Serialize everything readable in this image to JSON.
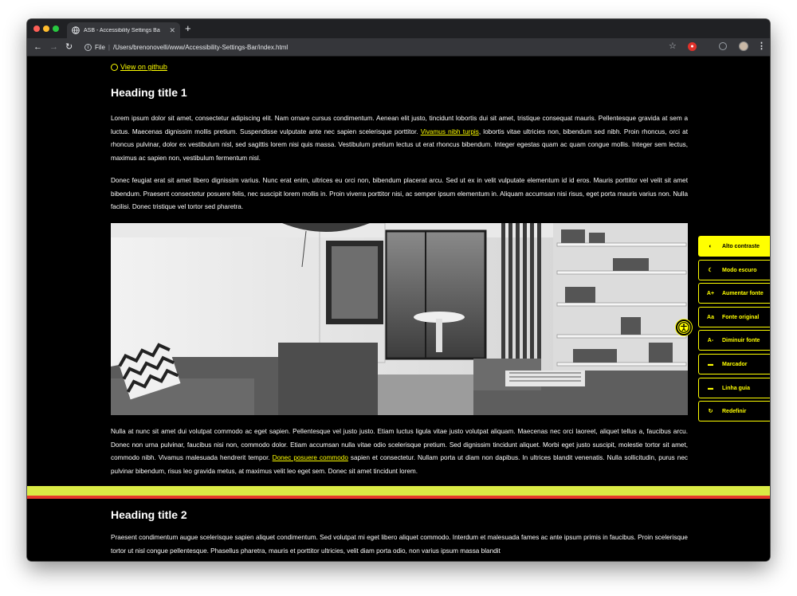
{
  "browser": {
    "tab_title": "ASB - Accessibility Settings Ba",
    "tab_close": "✕",
    "new_tab": "+",
    "url_scheme": "File",
    "url_separator": "|",
    "url_path": "/Users/brenonovelli/www/Accessibility-Settings-Bar/index.html"
  },
  "page": {
    "github_link": "View on github",
    "heading1": "Heading title 1",
    "para1_a": "Lorem ipsum dolor sit amet, consectetur adipiscing elit. Nam ornare cursus condimentum. Aenean elit justo, tincidunt lobortis dui sit amet, tristique consequat mauris. Pellentesque gravida at sem a luctus. Maecenas dignissim mollis pretium. Suspendisse vulputate ante nec sapien scelerisque porttitor. ",
    "para1_link": "Vivamus nibh turpis",
    "para1_b": ", lobortis vitae ultricies non, bibendum sed nibh. Proin rhoncus, orci at rhoncus pulvinar, dolor ex vestibulum nisl, sed sagittis lorem nisi quis massa. Vestibulum pretium lectus ut erat rhoncus bibendum. Integer egestas quam ac quam congue mollis. Integer sem lectus, maximus ac sapien non, vestibulum fermentum nisl.",
    "para2": "Donec feugiat erat sit amet libero dignissim varius. Nunc erat enim, ultrices eu orci non, bibendum placerat arcu. Sed ut ex in velit vulputate elementum id id eros. Mauris porttitor vel velit sit amet bibendum. Praesent consectetur posuere felis, nec suscipit lorem mollis in. Proin viverra porttitor nisi, ac semper ipsum elementum in. Aliquam accumsan nisi risus, eget porta mauris varius non. Nulla facilisi. Donec tristique vel tortor sed pharetra.",
    "para3_a": "Nulla at nunc sit amet dui volutpat commodo ac eget sapien. Pellentesque vel justo justo. Etiam luctus ligula vitae justo volutpat aliquam. Maecenas nec orci laoreet, aliquet tellus a, faucibus arcu. Donec non urna pulvinar, faucibus nisi non, commodo dolor. Etiam accumsan nulla vitae odio scelerisque pretium. Sed dignissim tincidunt aliquet. Morbi eget justo suscipit, molestie tortor sit amet, commodo nibh. Vivamus malesuada hendrerit tempor. ",
    "para3_link": "Donec posuere commodo",
    "para3_b": " sapien et consectetur. Nullam porta ut diam non dapibus. In ultrices blandit venenatis. Nulla sollicitudin, purus nec pulvinar bibendum, risus leo gravida metus, at maximus velit leo eget sem. Donec sit amet tincidunt lorem.",
    "heading2": "Heading title 2",
    "para4": "Praesent condimentum augue scelerisque sapien aliquet condimentum. Sed volutpat mi eget libero aliquet commodo. Interdum et malesuada fames ac ante ipsum primis in faucibus. Proin scelerisque tortor ut nisl congue pellentesque. Phasellus pharetra, mauris et porttitor ultricies, velit diam porta odio, non varius ipsum massa blandit"
  },
  "a11y_bar": {
    "items": [
      {
        "icon": "◐",
        "label": "Alto contraste",
        "icon_name": "contrast-icon",
        "active": true
      },
      {
        "icon": "☾",
        "label": "Modo escuro",
        "icon_name": "moon-icon",
        "active": false
      },
      {
        "icon": "A+",
        "label": "Aumentar fonte",
        "icon_name": "font-increase-icon",
        "active": false
      },
      {
        "icon": "Aa",
        "label": "Fonte original",
        "icon_name": "font-original-icon",
        "active": false
      },
      {
        "icon": "A-",
        "label": "Diminuir fonte",
        "icon_name": "font-decrease-icon",
        "active": false
      },
      {
        "icon": "▬",
        "label": "Marcador",
        "icon_name": "marker-icon",
        "active": false
      },
      {
        "icon": "▬",
        "label": "Linha guia",
        "icon_name": "guide-line-icon",
        "active": false
      },
      {
        "icon": "↻",
        "label": "Redefinir",
        "icon_name": "reset-icon",
        "active": false
      }
    ]
  },
  "colors": {
    "accent": "#ffff00",
    "reading_guide": "#edff4b",
    "guide_underline": "#e53a2c",
    "page_bg": "#000000"
  }
}
